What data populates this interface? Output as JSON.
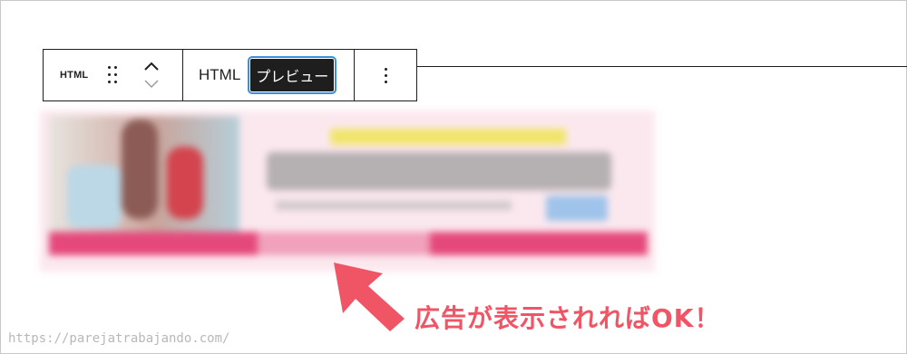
{
  "toolbar": {
    "block_type_label": "HTML",
    "tabs": [
      {
        "label": "HTML",
        "selected": false
      },
      {
        "label": "プレビュー",
        "selected": true
      }
    ]
  },
  "annotation": {
    "text": "広告が表示されればOK！",
    "color": "#f05566"
  },
  "watermark": "https://parejatrabajando.com/",
  "colors": {
    "toolbar_border": "#1e1e1e",
    "selected_tab_bg": "#1e1e1e",
    "focus_ring": "#3b8fd8",
    "ad_band": "#e5497c"
  }
}
